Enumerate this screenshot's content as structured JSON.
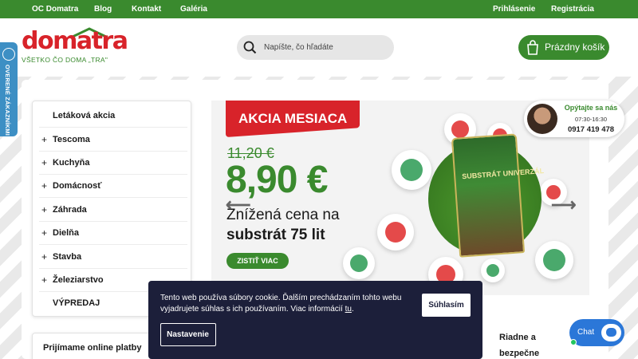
{
  "topbar": {
    "links": [
      "OC Domatra",
      "Blog",
      "Kontakt",
      "Galéria"
    ],
    "login": "Prihlásenie",
    "register": "Registrácia",
    "color": "#3a8a2e"
  },
  "header": {
    "logo_word": "domatra",
    "logo_tagline": "VŠETKO ČO DOMA „TRA\"",
    "search_placeholder": "Napíšte, čo hľadáte",
    "cart_label": "Prázdny košík"
  },
  "verified_badge": "OVERENÉ ZÁKAZNÍKMI",
  "categories": [
    {
      "label": "Letáková akcia",
      "expandable": false
    },
    {
      "label": "Tescoma",
      "expandable": true
    },
    {
      "label": "Kuchyňa",
      "expandable": true
    },
    {
      "label": "Domácnosť",
      "expandable": true
    },
    {
      "label": "Záhrada",
      "expandable": true
    },
    {
      "label": "Dielňa",
      "expandable": true
    },
    {
      "label": "Stavba",
      "expandable": true
    },
    {
      "label": "Železiarstvo",
      "expandable": true
    },
    {
      "label": "VÝPREDAJ",
      "expandable": false
    }
  ],
  "payments_title": "Prijímame online platby",
  "banner": {
    "tag": "AKCIA MESIACA",
    "old_price": "11,20 €",
    "new_price": "8,90 €",
    "line1": "Znížená cena na",
    "line2": "substrát 75 lit",
    "cta": "ZISTIŤ VIAC",
    "product_label": "SUBSTRÁT UNIVERZÁL"
  },
  "operator": {
    "title": "Opýtajte sa nás",
    "hours": "07:30-16:30",
    "phone": "0917 419 478"
  },
  "cookie": {
    "text": "Tento web používa súbory cookie. Ďalším prechádzaním tohto webu vyjadrujete súhlas s ich používaním. Viac informácií ",
    "link": "tu",
    "text_end": ".",
    "accept": "Súhlasím",
    "settings": "Nastavenie"
  },
  "safe_text": [
    "Riadne a",
    "bezpečne"
  ],
  "chat_label": "Chat"
}
